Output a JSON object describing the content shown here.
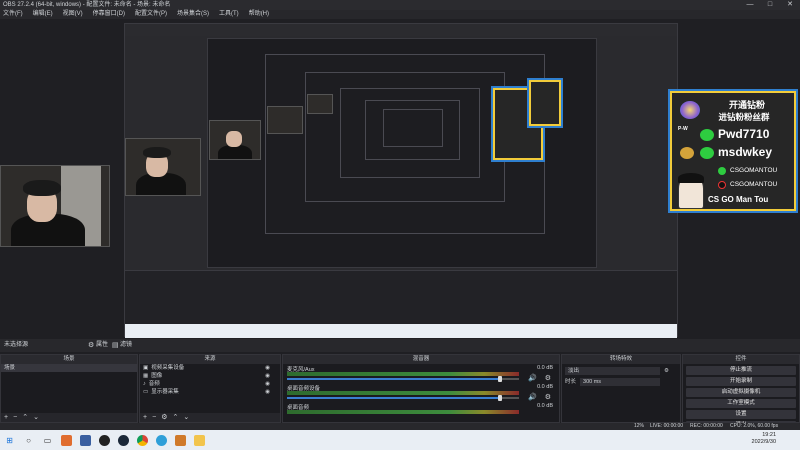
{
  "window": {
    "title": "OBS 27.2.4 (64-bit, windows) - 配置文件: 未命名 - 场景: 未命名",
    "controls": [
      "—",
      "□",
      "✕"
    ]
  },
  "menu": [
    "文件(F)",
    "编辑(E)",
    "视图(V)",
    "停靠窗口(D)",
    "配置文件(P)",
    "场景集合(S)",
    "工具(T)",
    "帮助(H)"
  ],
  "promo": {
    "title_line1": "开通钻粉",
    "title_line2": "进钻粉粉丝群",
    "prefix": "P-W",
    "wechat_id": "Pwd7710",
    "wechat2_id": "msdwkey",
    "channel1": "CSGOMANTOU",
    "channel2": "CSGOMANTOU",
    "footer": "CS GO Man Tou"
  },
  "scene_bar": {
    "label": "未选择源",
    "properties_btn": "属性",
    "filters_btn": "滤镜"
  },
  "docks": {
    "scenes": {
      "title": "场景",
      "items": [
        "场景"
      ]
    },
    "sources": {
      "title": "来源",
      "items": [
        "视频采集设备",
        "图像",
        "音频",
        "显示器采集"
      ]
    },
    "mixer": {
      "title": "混音器",
      "channels": [
        {
          "name": "麦克风/Aux",
          "db": "0.0 dB",
          "value": 0.92
        },
        {
          "name": "桌面音频设备",
          "db": "0.0 dB",
          "value": 0.92
        },
        {
          "name": "桌面音频",
          "db": "0.0 dB",
          "value": 0.92
        }
      ]
    },
    "transitions": {
      "title": "转场特效",
      "selected": "淡出",
      "duration_label": "时长",
      "duration_value": "300 ms"
    },
    "controls": {
      "title": "控件",
      "buttons": [
        "停止推流",
        "开始录制",
        "启动虚拟摄像机",
        "工作室模式",
        "设置",
        "退出"
      ]
    }
  },
  "status": {
    "live": "LIVE: 00:00:00",
    "rec": "REC: 00:00:00",
    "cpu": "CPU: 2.0%, 60.00 fps",
    "dropped": "12%"
  },
  "taskbar": {
    "time": "19:21",
    "date": "2022/9/30"
  },
  "colors": {
    "accent": "#3a7fd1",
    "promo_yellow": "#f2cc3a",
    "promo_border": "#2f7fcf"
  }
}
